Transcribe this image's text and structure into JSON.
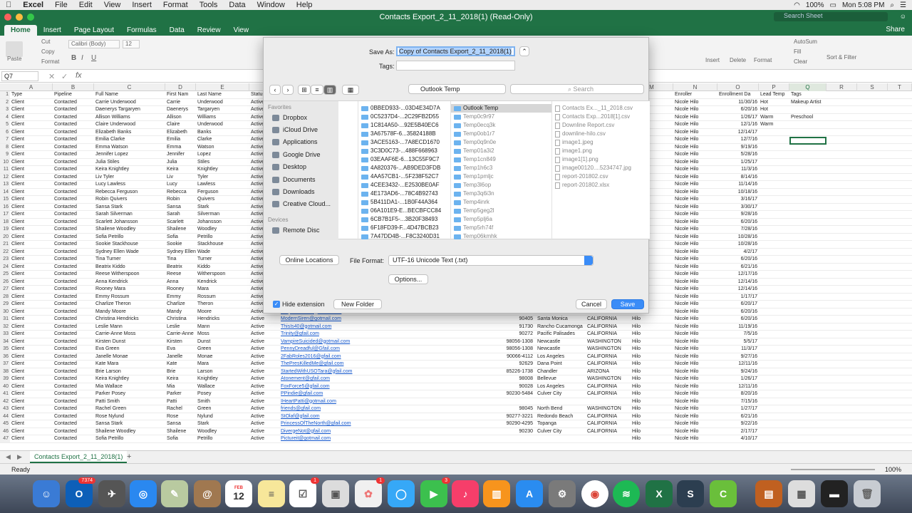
{
  "menubar": {
    "apple": "",
    "app": "Excel",
    "items": [
      "File",
      "Edit",
      "View",
      "Insert",
      "Format",
      "Tools",
      "Data",
      "Window",
      "Help"
    ],
    "battery": "100%",
    "clock": "Mon 5:08 PM"
  },
  "window": {
    "title": "Contacts Export_2_11_2018(1)  (Read-Only)",
    "search_placeholder": "Search Sheet",
    "share": "Share"
  },
  "ribbon": {
    "tabs": [
      "Home",
      "Insert",
      "Page Layout",
      "Formulas",
      "Data",
      "Review",
      "View"
    ],
    "paste": "Paste",
    "cut": "Cut",
    "copy": "Copy",
    "format": "Format",
    "font": "Calibri (Body)",
    "size": "12",
    "insert": "Insert",
    "delete": "Delete",
    "format_cells": "Format",
    "autosum": "AutoSum",
    "fill": "Fill",
    "clear": "Clear",
    "sort": "Sort & Filter"
  },
  "namebox": "Q7",
  "columns": {
    "left": [
      "A",
      "B",
      "C",
      "D",
      "E"
    ],
    "right": [
      "M",
      "N",
      "O",
      "P",
      "Q",
      "R",
      "S",
      "T"
    ]
  },
  "headers": {
    "a": "Type",
    "b": "Pipeline",
    "c": "Full Name",
    "d": "First Nam",
    "e": "Last Name",
    "f": "Status",
    "m": "",
    "n": "Enroller",
    "o": "Enrollment Da",
    "p": "Lead Temp",
    "q": "Tags"
  },
  "rows": [
    [
      "Client",
      "Contacted",
      "Carrie Underwood",
      "Carrie",
      "Underwood",
      "Active",
      "",
      "",
      "",
      "",
      "Hilo",
      "Nicole Hilo",
      "11/30/16",
      "Hot",
      "Makeup Artist"
    ],
    [
      "Client",
      "Contacted",
      "Daenerys Targaryen",
      "Daenerys",
      "Targaryen",
      "Active",
      "",
      "",
      "",
      "",
      "Hilo",
      "Nicole Hilo",
      "6/20/16",
      "Hot",
      ""
    ],
    [
      "Client",
      "Contacted",
      "Allison Williams",
      "Allison",
      "Williams",
      "Active",
      "",
      "",
      "",
      "",
      "Hilo",
      "Nicole Hilo",
      "1/26/17",
      "Warm",
      "Preschool"
    ],
    [
      "Client",
      "Contacted",
      "Claire Underwood",
      "Claire",
      "Underwood",
      "Active",
      "",
      "",
      "",
      "",
      "Hilo",
      "Nicole Hilo",
      "12/1/16",
      "Warm",
      ""
    ],
    [
      "Client",
      "Contacted",
      "Elizabeth Banks",
      "Elizabeth",
      "Banks",
      "Active",
      "",
      "",
      "",
      "",
      "Hilo",
      "Nicole Hilo",
      "12/14/17",
      "",
      ""
    ],
    [
      "Client",
      "Contacted",
      "Emilia Clarke",
      "Emilia",
      "Clarke",
      "Active",
      "",
      "",
      "",
      "",
      "Hilo",
      "Nicole Hilo",
      "12/7/16",
      "",
      ""
    ],
    [
      "Client",
      "Contacted",
      "Emma Watson",
      "Emma",
      "Watson",
      "Active",
      "",
      "",
      "",
      "",
      "Hilo",
      "Nicole Hilo",
      "9/19/16",
      "",
      ""
    ],
    [
      "Client",
      "Contacted",
      "Jennifer Lopez",
      "Jennifer",
      "Lopez",
      "Active",
      "",
      "",
      "",
      "",
      "Hilo",
      "Nicole Hilo",
      "5/28/16",
      "",
      ""
    ],
    [
      "Client",
      "Contacted",
      "Julia Stiles",
      "Julia",
      "Stiles",
      "Active",
      "",
      "",
      "",
      "",
      "Hilo",
      "Nicole Hilo",
      "1/25/17",
      "",
      ""
    ],
    [
      "Client",
      "Contacted",
      "Keira Knightley",
      "Keira",
      "Knightley",
      "Active",
      "",
      "",
      "",
      "",
      "Hilo",
      "Nicole Hilo",
      "11/3/16",
      "",
      ""
    ],
    [
      "Client",
      "Contacted",
      "Liv Tyler",
      "Liv",
      "Tyler",
      "Active",
      "",
      "",
      "",
      "",
      "Hilo",
      "Nicole Hilo",
      "8/14/16",
      "",
      ""
    ],
    [
      "Client",
      "Contacted",
      "Lucy Lawless",
      "Lucy",
      "Lawless",
      "Active",
      "",
      "",
      "",
      "",
      "Hilo",
      "Nicole Hilo",
      "11/14/16",
      "",
      ""
    ],
    [
      "Client",
      "Contacted",
      "Rebecca Ferguson",
      "Rebecca",
      "Ferguson",
      "Active",
      "",
      "",
      "",
      "",
      "Hilo",
      "Nicole Hilo",
      "10/18/16",
      "",
      ""
    ],
    [
      "Client",
      "Contacted",
      "Robin Quivers",
      "Robin",
      "Quivers",
      "Active",
      "",
      "",
      "",
      "",
      "Hilo",
      "Nicole Hilo",
      "3/16/17",
      "",
      ""
    ],
    [
      "Client",
      "Contacted",
      "Sansa Stark",
      "Sansa",
      "Stark",
      "Active",
      "",
      "",
      "",
      "",
      "Hilo",
      "Nicole Hilo",
      "3/30/17",
      "",
      ""
    ],
    [
      "Client",
      "Contacted",
      "Sarah Silverman",
      "Sarah",
      "Silverman",
      "Active",
      "",
      "",
      "",
      "",
      "Hilo",
      "Nicole Hilo",
      "9/28/16",
      "",
      ""
    ],
    [
      "Client",
      "Contacted",
      "Scarlett Johansson",
      "Scarlett",
      "Johansson",
      "Active",
      "",
      "",
      "",
      "",
      "Hilo",
      "Nicole Hilo",
      "6/20/16",
      "",
      ""
    ],
    [
      "Client",
      "Contacted",
      "Shailene Woodley",
      "Shailene",
      "Woodley",
      "Active",
      "",
      "",
      "",
      "",
      "Hilo",
      "Nicole Hilo",
      "7/28/16",
      "",
      ""
    ],
    [
      "Client",
      "Contacted",
      "Sofia Petrillo",
      "Sofia",
      "Petrillo",
      "Active",
      "",
      "",
      "",
      "",
      "Hilo",
      "Nicole Hilo",
      "10/28/16",
      "",
      ""
    ],
    [
      "Client",
      "Contacted",
      "Sookie Stackhouse",
      "Sookie",
      "Stackhouse",
      "Active",
      "",
      "",
      "",
      "",
      "Hilo",
      "Nicole Hilo",
      "10/28/16",
      "",
      ""
    ],
    [
      "Client",
      "Contacted",
      "Sydney Ellen Wade",
      "Sydney Ellen",
      "Wade",
      "Active",
      "",
      "",
      "",
      "",
      "Hilo",
      "Nicole Hilo",
      "4/2/17",
      "",
      ""
    ],
    [
      "Client",
      "Contacted",
      "Tina Turner",
      "Tina",
      "Turner",
      "Active",
      "",
      "",
      "",
      "",
      "Hilo",
      "Nicole Hilo",
      "6/20/16",
      "",
      ""
    ],
    [
      "Client",
      "Contacted",
      "Beatrix Kiddo",
      "Beatrix",
      "Kiddo",
      "Active",
      "",
      "",
      "",
      "",
      "Hilo",
      "Nicole Hilo",
      "6/21/16",
      "",
      ""
    ],
    [
      "Client",
      "Contacted",
      "Reese Witherspoon",
      "Reese",
      "Witherspoon",
      "Active",
      "",
      "",
      "",
      "",
      "Hilo",
      "Nicole Hilo",
      "12/17/16",
      "",
      ""
    ],
    [
      "Client",
      "Contacted",
      "Anna Kendrick",
      "Anna",
      "Kendrick",
      "Active",
      "",
      "",
      "",
      "",
      "Hilo",
      "Nicole Hilo",
      "12/14/16",
      "",
      ""
    ],
    [
      "Client",
      "Contacted",
      "Rooney Mara",
      "Rooney",
      "Mara",
      "Active",
      "",
      "",
      "",
      "",
      "Hilo",
      "Nicole Hilo",
      "12/14/16",
      "",
      ""
    ],
    [
      "Client",
      "Contacted",
      "Emmy Rossum",
      "Emmy",
      "Rossum",
      "Active",
      "",
      "",
      "",
      "",
      "Hilo",
      "Nicole Hilo",
      "1/17/17",
      "",
      ""
    ],
    [
      "Client",
      "Contacted",
      "Charlize Theron",
      "Charlize",
      "Theron",
      "Active",
      "",
      "",
      "",
      "",
      "Hilo",
      "Nicole Hilo",
      "6/20/17",
      "",
      ""
    ],
    [
      "Client",
      "Contacted",
      "Mandy Moore",
      "Mandy",
      "Moore",
      "Active",
      "SurpriseRole@gotmail.com",
      "90272",
      "Pacific Palisades",
      "CALIFORNIA",
      "Hilo",
      "Nicole Hilo",
      "6/20/16",
      "",
      ""
    ],
    [
      "Client",
      "Contacted",
      "Christina Hendricks",
      "Christina",
      "Hendricks",
      "Active",
      "ModernSiren@gotmail.com",
      "90405",
      "Santa Monica",
      "CALIFORNIA",
      "Hilo",
      "Nicole Hilo",
      "6/20/16",
      "",
      ""
    ],
    [
      "Client",
      "Contacted",
      "Leslie Mann",
      "Leslie",
      "Mann",
      "Active",
      "ThisIs40@gotmail.com",
      "91730",
      "Rancho Cucamonga",
      "CALIFORNIA",
      "Hilo",
      "Nicole Hilo",
      "11/19/16",
      "",
      ""
    ],
    [
      "Client",
      "Contacted",
      "Carrie-Anne Moss",
      "Carrie-Anne",
      "Moss",
      "Active",
      "Trinity@gfail.com",
      "90272",
      "Pacific Palisades",
      "CALIFORNIA",
      "Hilo",
      "Nicole Hilo",
      "7/5/16",
      "",
      ""
    ],
    [
      "Client",
      "Contacted",
      "Kirsten Dunst",
      "Kirsten",
      "Dunst",
      "Active",
      "VampireSuicided@gotmail.com",
      "98056-1308",
      "Newcastle",
      "WASHINGTON",
      "Hilo",
      "Nicole Hilo",
      "5/5/17",
      "",
      ""
    ],
    [
      "Client",
      "Contacted",
      "Eva Green",
      "Eva",
      "Green",
      "Active",
      "PennyDreadful@Gfail.com",
      "98056-1308",
      "Newcastle",
      "WASHINGTON",
      "Hilo",
      "Nicole Hilo",
      "11/3/17",
      "",
      ""
    ],
    [
      "Client",
      "Contacted",
      "Janelle Monae",
      "Janelle",
      "Monae",
      "Active",
      "2FabRoles2016@gfail.com",
      "90066-4112",
      "Los Angeles",
      "CALIFORNIA",
      "Hilo",
      "Nicole Hilo",
      "9/27/16",
      "",
      ""
    ],
    [
      "Client",
      "Contacted",
      "Kate Mara",
      "Kate",
      "Mara",
      "Active",
      "ThePresKilledMe@gfail.com",
      "92629",
      "Dana Point",
      "CALIFORNIA",
      "Hilo",
      "Nicole Hilo",
      "12/11/16",
      "",
      ""
    ],
    [
      "Client",
      "Contacted",
      "Brie Larson",
      "Brie",
      "Larson",
      "Active",
      "StartedWithUSOTara@gfail.com",
      "85226-1738",
      "Chandler",
      "ARIZONA",
      "Hilo",
      "Nicole Hilo",
      "9/24/16",
      "",
      ""
    ],
    [
      "Client",
      "Contacted",
      "Keira Knightley",
      "Keira",
      "Knightley",
      "Active",
      "Atonement@gfail.com",
      "98008",
      "Bellevue",
      "WASHINGTON",
      "Hilo",
      "Nicole Hilo",
      "1/26/17",
      "",
      ""
    ],
    [
      "Client",
      "Contacted",
      "Mia Wallace",
      "Mia",
      "Wallace",
      "Active",
      "FoxForce5@gfail.com",
      "90028",
      "Los Angeles",
      "CALIFORNIA",
      "Hilo",
      "Nicole Hilo",
      "12/11/16",
      "",
      ""
    ],
    [
      "Client",
      "Contacted",
      "Parker Posey",
      "Parker",
      "Posey",
      "Active",
      "PPindie@gfail.com",
      "90230-5484",
      "Culver City",
      "CALIFORNIA",
      "Hilo",
      "Nicole Hilo",
      "8/20/16",
      "",
      ""
    ],
    [
      "Client",
      "Contacted",
      "Patti Smith",
      "Patti",
      "Smith",
      "Active",
      "IHeartPatti@gotmail.com",
      "",
      "",
      "",
      "Hilo",
      "Nicole Hilo",
      "7/15/16",
      "",
      ""
    ],
    [
      "Client",
      "Contacted",
      "Rachel Green",
      "Rachel",
      "Green",
      "Active",
      "friends@gfail.com",
      "98045",
      "North Bend",
      "WASHINGTON",
      "Hilo",
      "Nicole Hilo",
      "1/27/17",
      "",
      ""
    ],
    [
      "Client",
      "Contacted",
      "Rose Nylund",
      "Rose",
      "Nylund",
      "Active",
      "StOlaf@gfail.com",
      "90277-3221",
      "Redondo Beach",
      "CALIFORNIA",
      "Hilo",
      "Nicole Hilo",
      "6/21/16",
      "",
      ""
    ],
    [
      "Client",
      "Contacted",
      "Sansa Stark",
      "Sansa",
      "Stark",
      "Active",
      "PrincessOfTheNorth@gfail.com",
      "90290-4295",
      "Topanga",
      "CALIFORNIA",
      "Hilo",
      "Nicole Hilo",
      "9/22/16",
      "",
      ""
    ],
    [
      "Client",
      "Contacted",
      "Shailene Woodley",
      "Shailene",
      "Woodley",
      "Active",
      "DivergeNot@gfail.com",
      "90230",
      "Culver City",
      "CALIFORNIA",
      "Hilo",
      "Nicole Hilo",
      "2/17/17",
      "",
      ""
    ],
    [
      "Client",
      "Contacted",
      "Sofia Petrillo",
      "Sofia",
      "Petrillo",
      "Active",
      "Pictureit@gotmail.com",
      "",
      "",
      "",
      "Hilo",
      "Nicole Hilo",
      "4/10/17",
      "",
      ""
    ]
  ],
  "sheet_tab": "Contacts Export_2_11_2018(1)",
  "status": {
    "ready": "Ready",
    "zoom": "100%"
  },
  "dialog": {
    "save_as_label": "Save As:",
    "save_as_value": "Copy of Contacts Export_2_11_2018(1)",
    "tags_label": "Tags:",
    "location": "Outlook Temp",
    "search_placeholder": "Search",
    "favorites_header": "Favorites",
    "favorites": [
      "Dropbox",
      "iCloud Drive",
      "Applications",
      "Google Drive",
      "Desktop",
      "Documents",
      "Downloads",
      "Creative Cloud..."
    ],
    "devices_header": "Devices",
    "devices": [
      "Remote Disc"
    ],
    "col1": [
      "0BBED933-...03D4E34D7A",
      "0C5237D4-...2C29FB2D55",
      "1C814A50-...92E5B40EC6",
      "3A67578F-6...35824188B",
      "3ACE5163-...7A8ECD1670",
      "3C3D0C73-...488F668963",
      "03EAAF6E-6...13C55F9C7",
      "4A820376-...AB9DED3FDB",
      "4AA57CB1-...5F238F52C7",
      "4CEE3432-...E2530BE0AF",
      "4E173AD6-...78C4B92743",
      "5B411DA1-...1B0F44A364",
      "06A101E9-E...BECBFCC84",
      "6CB7B1F5-...3B20F38493",
      "6F18FD39-F...4D47BCB23",
      "7A47DD4B-...F8C3240D31"
    ],
    "col2": [
      "Outlook Temp",
      "Temp0c9r97",
      "Temp0ecq3k",
      "Temp0ob1r7",
      "Temp0q9n0e",
      "Temp01a3i2",
      "Temp1cn849",
      "Temp1h6c3",
      "Temp1pmljc",
      "Temp3l6op",
      "Temp3q6i3n",
      "Temp4inrk",
      "Temp5geg2l",
      "Temp5plj6a",
      "Temp5rh74f",
      "Temp06kmhk"
    ],
    "col3": [
      "Contacts Ex..._11_2018.csv",
      "Contacts Exp...2018[1].csv",
      "Downline Report.csv",
      "downline-hilo.csv",
      "image1.jpeg",
      "image1.png",
      "image1[1].png",
      "image00120....5234747.jpg",
      "report-201802.csv",
      "report-201802.xlsx"
    ],
    "online_locations": "Online Locations",
    "file_format_label": "File Format:",
    "file_format": "UTF-16 Unicode Text (.txt)",
    "options": "Options...",
    "hide_extension": "Hide extension",
    "new_folder": "New Folder",
    "cancel": "Cancel",
    "save": "Save"
  },
  "dock": {
    "mail_badge": "7374",
    "calendar_month": "FEB",
    "calendar_day": "12",
    "reminders_badge": "1",
    "photos_badge": "1",
    "facetime_badge": "3"
  },
  "colors": {
    "excel_green": "#207245",
    "accent": "#3a8cf7"
  }
}
